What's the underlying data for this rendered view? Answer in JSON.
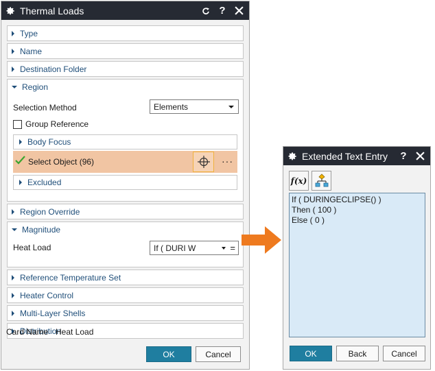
{
  "main_dialog": {
    "title": "Thermal Loads",
    "icons": [
      "gear-icon",
      "reset-icon",
      "help-icon",
      "close-icon"
    ],
    "groups": [
      {
        "label": "Type",
        "expanded": false
      },
      {
        "label": "Name",
        "expanded": false
      },
      {
        "label": "Destination Folder",
        "expanded": false
      }
    ],
    "region": {
      "label": "Region",
      "selection_method_label": "Selection Method",
      "selection_method_value": "Elements",
      "group_reference_label": "Group Reference",
      "body_focus_label": "Body Focus",
      "select_object_label": "Select Object (96)",
      "more_label": "···",
      "excluded_label": "Excluded"
    },
    "region_override_label": "Region Override",
    "magnitude": {
      "label": "Magnitude",
      "heat_load_label": "Heat Load",
      "heat_load_value": "If ( DURI W"
    },
    "groups_after": [
      {
        "label": "Reference Temperature Set"
      },
      {
        "label": "Heater Control"
      },
      {
        "label": "Multi-Layer Shells"
      },
      {
        "label": "Distribution"
      }
    ],
    "card_name_label": "Card Name",
    "card_name_value": "Heat Load",
    "ok_label": "OK",
    "cancel_label": "Cancel"
  },
  "ext_dialog": {
    "title": "Extended Text Entry",
    "fx_label": "f(x)",
    "text_lines": [
      "If ( DURINGECLIPSE() )",
      "Then ( 100 )",
      "Else ( 0 )"
    ],
    "ok_label": "OK",
    "back_label": "Back",
    "cancel_label": "Cancel"
  },
  "colors": {
    "titlebar": "#262a33",
    "accent_blue": "#1f7ea0",
    "selection_highlight": "#f1c5a3",
    "arrow_orange": "#ee7a1f",
    "textarea_bg": "#d9eaf7"
  }
}
